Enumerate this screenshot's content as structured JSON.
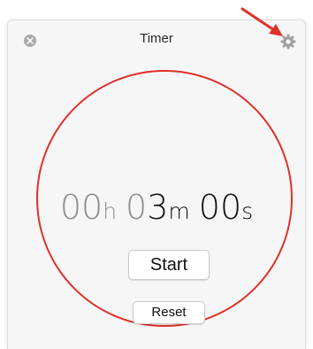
{
  "window": {
    "title": "Timer"
  },
  "icons": {
    "close": "close-icon",
    "settings": "gear-icon",
    "annotation": "red-arrow"
  },
  "timer": {
    "hours": "00",
    "hours_unit": "h",
    "minutes": "03",
    "minutes_unit": "m",
    "seconds": "00",
    "seconds_unit": "s"
  },
  "buttons": {
    "start_label": "Start",
    "reset_label": "Reset"
  },
  "colors": {
    "ring": "#e0302a",
    "arrow": "#e0302a",
    "dim_digits": "#8e8e8e",
    "active_digits": "#111111"
  }
}
